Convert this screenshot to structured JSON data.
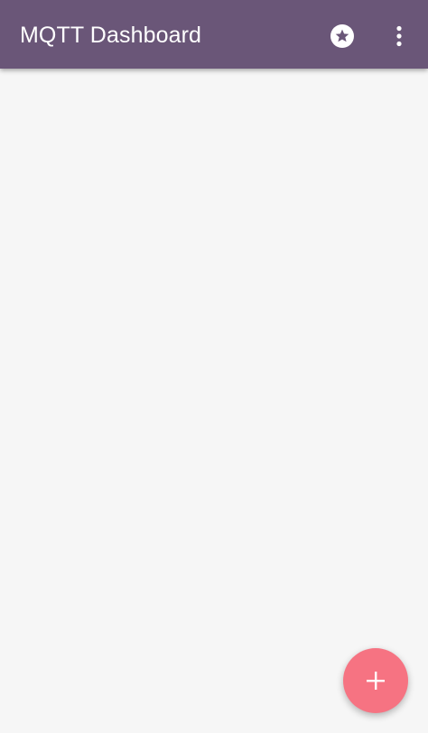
{
  "toolbar": {
    "title": "MQTT Dashboard",
    "background": "#6a5678",
    "actions": [
      {
        "icon": "star-circle-icon"
      },
      {
        "icon": "more-vert-icon"
      }
    ]
  },
  "main": {
    "background": "#f6f6f6"
  },
  "fab": {
    "icon": "add-icon",
    "color": "#f67382"
  }
}
